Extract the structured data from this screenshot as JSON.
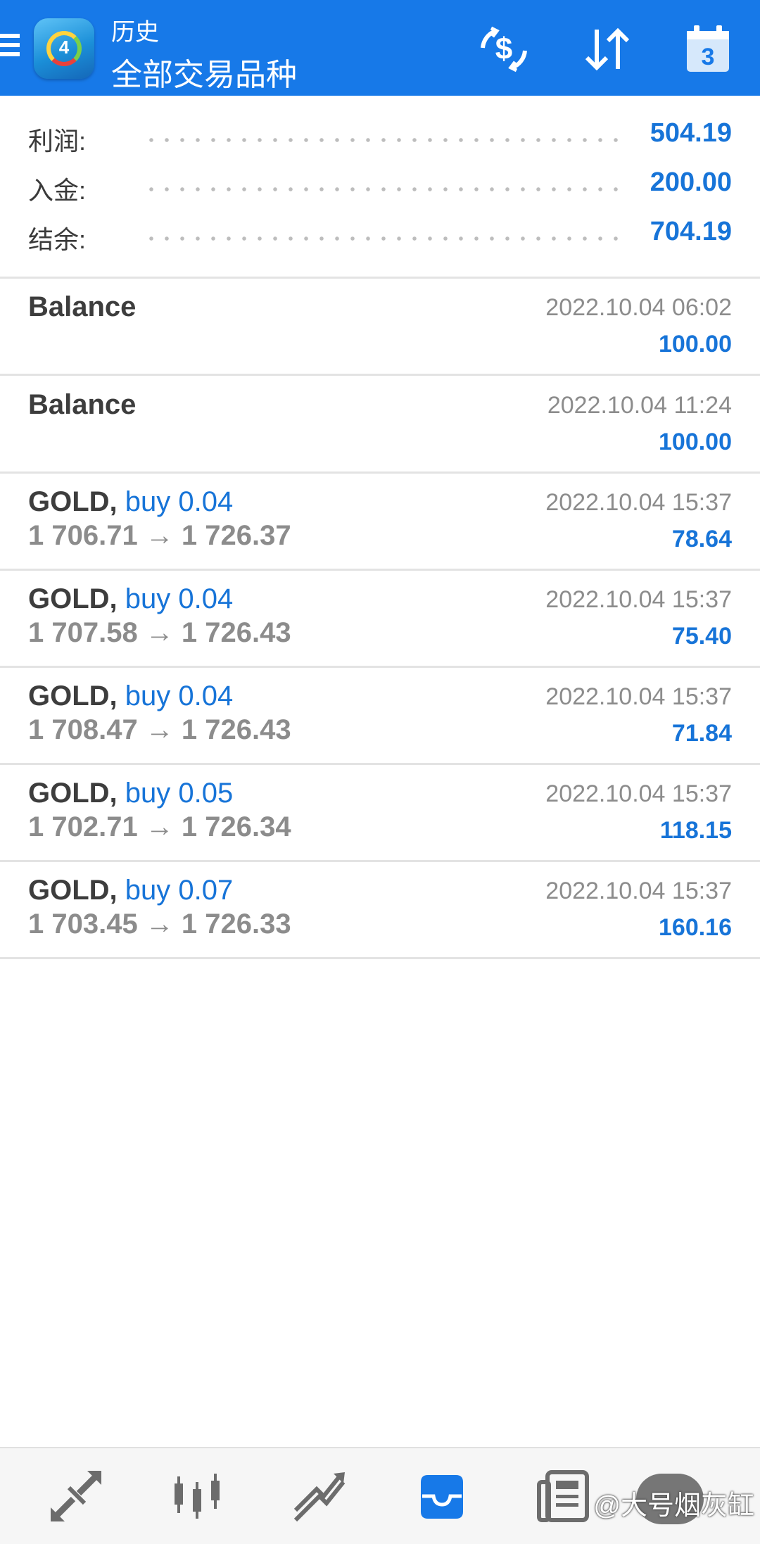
{
  "header": {
    "subtitle": "历史",
    "title": "全部交易品种",
    "logo_number": "4",
    "calendar_day": "3",
    "icons": [
      "menu-icon",
      "currency-exchange-icon",
      "sort-icon",
      "calendar-icon"
    ]
  },
  "summary": [
    {
      "label": "利润:",
      "value": "504.19"
    },
    {
      "label": "入金:",
      "value": "200.00"
    },
    {
      "label": "结余:",
      "value": "704.19"
    }
  ],
  "history": [
    {
      "symbol": "Balance",
      "type": "",
      "prices": "",
      "time": "2022.10.04 06:02",
      "profit": "100.00"
    },
    {
      "symbol": "Balance",
      "type": "",
      "prices": "",
      "time": "2022.10.04 11:24",
      "profit": "100.00"
    },
    {
      "symbol": "GOLD,",
      "type": "buy 0.04",
      "prices": "1 706.71 → 1 726.37",
      "time": "2022.10.04 15:37",
      "profit": "78.64"
    },
    {
      "symbol": "GOLD,",
      "type": "buy 0.04",
      "prices": "1 707.58 → 1 726.43",
      "time": "2022.10.04 15:37",
      "profit": "75.40"
    },
    {
      "symbol": "GOLD,",
      "type": "buy 0.04",
      "prices": "1 708.47 → 1 726.43",
      "time": "2022.10.04 15:37",
      "profit": "71.84"
    },
    {
      "symbol": "GOLD,",
      "type": "buy 0.05",
      "prices": "1 702.71 → 1 726.34",
      "time": "2022.10.04 15:37",
      "profit": "118.15"
    },
    {
      "symbol": "GOLD,",
      "type": "buy 0.07",
      "prices": "1 703.45 → 1 726.33",
      "time": "2022.10.04 15:37",
      "profit": "160.16"
    }
  ],
  "bottom_nav": {
    "items": [
      "quotes-icon",
      "chart-icon",
      "trade-icon",
      "history-icon",
      "news-icon"
    ],
    "active": "history-icon"
  },
  "watermark": "@大号烟灰缸",
  "colors": {
    "header": "#1779e8",
    "accent": "#1774d8",
    "muted": "#8c8c8c",
    "text": "#3d3d3d"
  }
}
